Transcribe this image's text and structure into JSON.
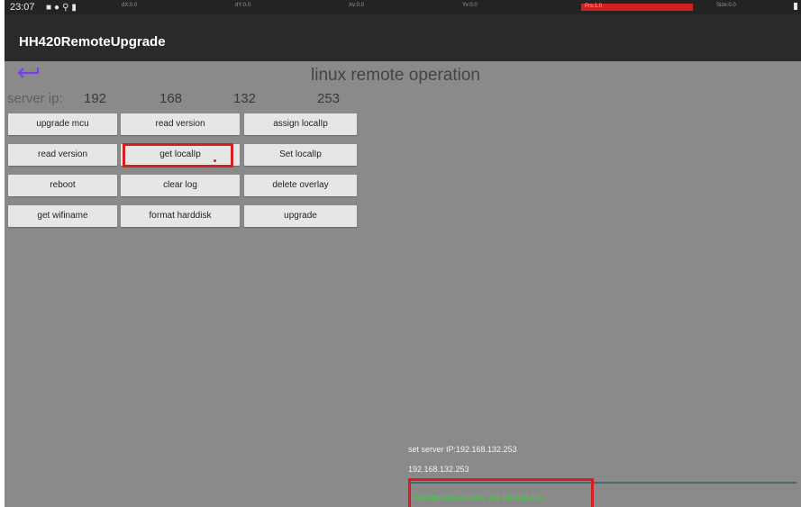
{
  "status_bar": {
    "time": "23:07",
    "overlays": [
      "dX:0.0",
      "dY:0.0",
      "Xv:0.0",
      "Yv:0.0"
    ],
    "prs": "Prs:1.0",
    "size": "Size:0.0"
  },
  "app": {
    "title": "HH420RemoteUpgrade"
  },
  "page": {
    "title": "linux remote operation"
  },
  "server": {
    "label": "server ip:",
    "octets": [
      "192",
      "168",
      "132",
      "253"
    ],
    "separators": [
      ".",
      ".",
      "."
    ]
  },
  "buttons": {
    "upgrade_mcu": "upgrade mcu",
    "read_version_1": "read version",
    "assign_localip": "assign localIp",
    "read_version_2": "read version",
    "get_localip": "get localIp",
    "set_localip": "Set localIp",
    "reboot": "reboot",
    "clear_log": "clear log",
    "delete_overlay": "delete overlay",
    "get_wifiname": "get wifiname",
    "format_harddisk": "format harddisk",
    "upgrade": "upgrade"
  },
  "log": {
    "line1": "set server IP:192.168.132.253",
    "line2": "192.168.132.253",
    "result": "read address     success: 192.168.132.253"
  },
  "colors": {
    "highlight": "#d42020",
    "success_text": "#37d837",
    "back_icon": "#7a3df0"
  }
}
